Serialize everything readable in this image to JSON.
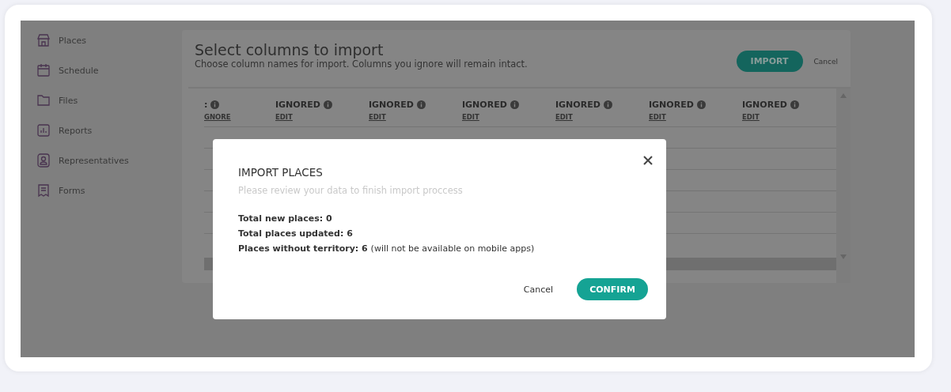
{
  "sidebar": {
    "items": [
      {
        "label": "Places"
      },
      {
        "label": "Schedule"
      },
      {
        "label": "Files"
      },
      {
        "label": "Reports"
      },
      {
        "label": "Representatives"
      },
      {
        "label": "Forms"
      }
    ]
  },
  "header": {
    "title": "Select columns to import",
    "subtitle": "Choose column names for import. Columns you ignore will remain intact.",
    "import_button": "IMPORT",
    "cancel_link": "Cancel"
  },
  "table": {
    "columns": [
      {
        "label": ":",
        "action": "GNORE"
      },
      {
        "label": "IGNORED",
        "action": "EDIT"
      },
      {
        "label": "IGNORED",
        "action": "EDIT"
      },
      {
        "label": "IGNORED",
        "action": "EDIT"
      },
      {
        "label": "IGNORED",
        "action": "EDIT"
      },
      {
        "label": "IGNORED",
        "action": "EDIT"
      },
      {
        "label": "IGNORED",
        "action": "EDIT"
      }
    ]
  },
  "dialog": {
    "title": "IMPORT PLACES",
    "subtitle": "Please review your data to finish import proccess",
    "stats": [
      {
        "label": "Total new places: 0"
      },
      {
        "label": "Total places updated: 6"
      },
      {
        "label": "Places without territory: 6",
        "note": "(will not be available on mobile apps)"
      }
    ],
    "cancel_button": "Cancel",
    "confirm_button": "CONFIRM"
  }
}
